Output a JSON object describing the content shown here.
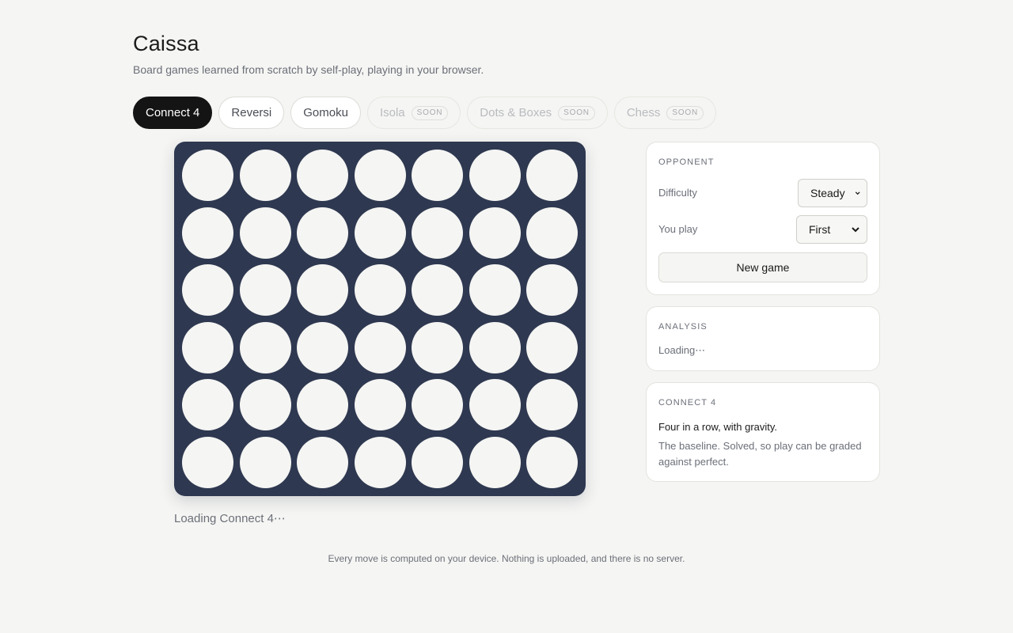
{
  "header": {
    "title": "Caissa",
    "subtitle": "Board games learned from scratch by self-play, playing in your browser."
  },
  "tabs": [
    {
      "label": "Connect 4",
      "state": "active",
      "badge": ""
    },
    {
      "label": "Reversi",
      "state": "enabled",
      "badge": ""
    },
    {
      "label": "Gomoku",
      "state": "enabled",
      "badge": ""
    },
    {
      "label": "Isola",
      "state": "disabled",
      "badge": "SOON"
    },
    {
      "label": "Dots & Boxes",
      "state": "disabled",
      "badge": "SOON"
    },
    {
      "label": "Chess",
      "state": "disabled",
      "badge": "SOON"
    }
  ],
  "board": {
    "rows": 6,
    "columns": 7,
    "cells": [
      [
        "empty",
        "empty",
        "empty",
        "empty",
        "empty",
        "empty",
        "empty"
      ],
      [
        "empty",
        "empty",
        "empty",
        "empty",
        "empty",
        "empty",
        "empty"
      ],
      [
        "empty",
        "empty",
        "empty",
        "empty",
        "empty",
        "empty",
        "empty"
      ],
      [
        "empty",
        "empty",
        "empty",
        "empty",
        "empty",
        "empty",
        "empty"
      ],
      [
        "empty",
        "empty",
        "empty",
        "empty",
        "empty",
        "empty",
        "empty"
      ],
      [
        "empty",
        "empty",
        "empty",
        "empty",
        "empty",
        "empty",
        "empty"
      ]
    ],
    "status": "Loading Connect 4⋯"
  },
  "opponent": {
    "heading": "OPPONENT",
    "difficulty_label": "Difficulty",
    "difficulty_value": "Steady",
    "you_play_label": "You play",
    "you_play_value": "First",
    "new_game_label": "New game"
  },
  "analysis": {
    "heading": "ANALYSIS",
    "text": "Loading⋯"
  },
  "game_info": {
    "heading": "CONNECT 4",
    "tagline": "Four in a row, with gravity.",
    "description": "The baseline. Solved, so play can be graded against perfect."
  },
  "footer": {
    "note": "Every move is computed on your device. Nothing is uploaded, and there is no server."
  },
  "colors": {
    "board": "#2e3850",
    "cell_empty": "#f5f5f3",
    "active_tab": "#141414",
    "background": "#f5f5f3"
  },
  "icons": {
    "select_arrow": "chevron-down-icon"
  }
}
